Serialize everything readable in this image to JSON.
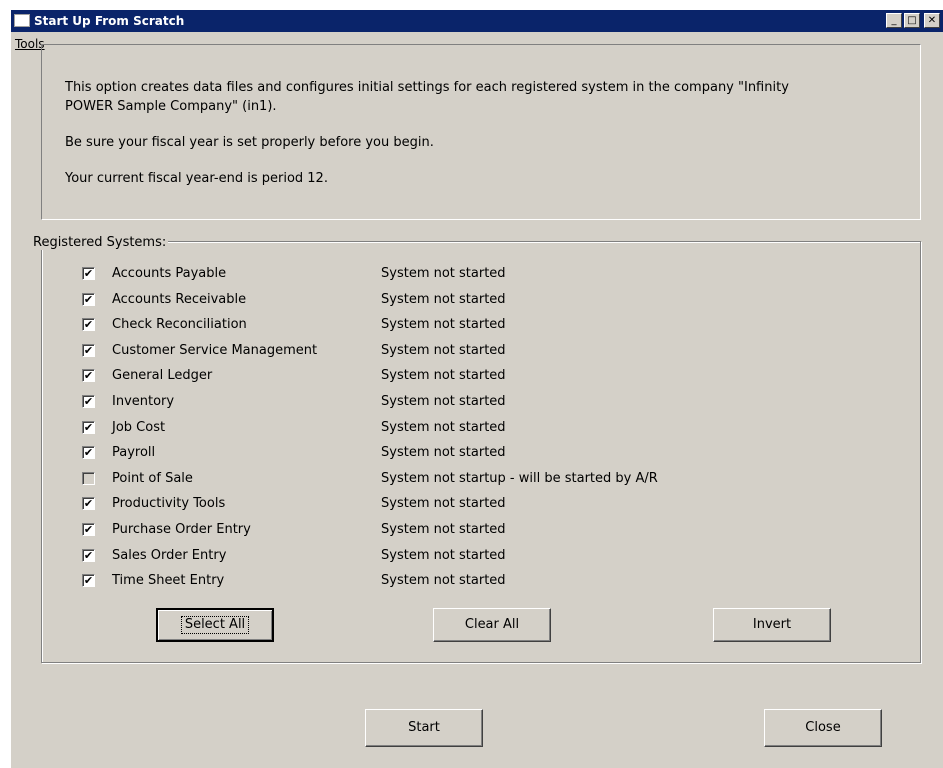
{
  "window": {
    "title": "Start Up From Scratch",
    "minimize_glyph": "_",
    "maximize_glyph": "□",
    "close_glyph": "✕"
  },
  "menu": {
    "tools_label": "Tools"
  },
  "info": {
    "line1": "This option creates data files and configures initial settings for each registered system in the company \"Infinity",
    "line2": "POWER Sample Company\" (in1).",
    "line3": "Be sure your fiscal year is set properly before you begin.",
    "line4": "Your current fiscal year-end is period 12."
  },
  "systems": {
    "legend": "Registered Systems:",
    "items": [
      {
        "name": "Accounts Payable",
        "status": "System not started",
        "checked": true
      },
      {
        "name": "Accounts Receivable",
        "status": "System not started",
        "checked": true
      },
      {
        "name": "Check Reconciliation",
        "status": "System not started",
        "checked": true
      },
      {
        "name": "Customer Service Management",
        "status": "System not started",
        "checked": true
      },
      {
        "name": "General Ledger",
        "status": "System not started",
        "checked": true
      },
      {
        "name": "Inventory",
        "status": "System not started",
        "checked": true
      },
      {
        "name": "Job Cost",
        "status": "System not started",
        "checked": true
      },
      {
        "name": "Payroll",
        "status": "System not started",
        "checked": true
      },
      {
        "name": "Point of Sale",
        "status": "System not startup - will be started by A/R",
        "checked": false
      },
      {
        "name": "Productivity Tools",
        "status": "System not started",
        "checked": true
      },
      {
        "name": "Purchase Order Entry",
        "status": "System not started",
        "checked": true
      },
      {
        "name": "Sales Order Entry",
        "status": "System not started",
        "checked": true
      },
      {
        "name": "Time Sheet Entry",
        "status": "System not started",
        "checked": true
      }
    ]
  },
  "buttons": {
    "select_all": "Select All",
    "clear_all": "Clear All",
    "invert": "Invert",
    "start": "Start",
    "close": "Close"
  },
  "check_glyph": "✔"
}
